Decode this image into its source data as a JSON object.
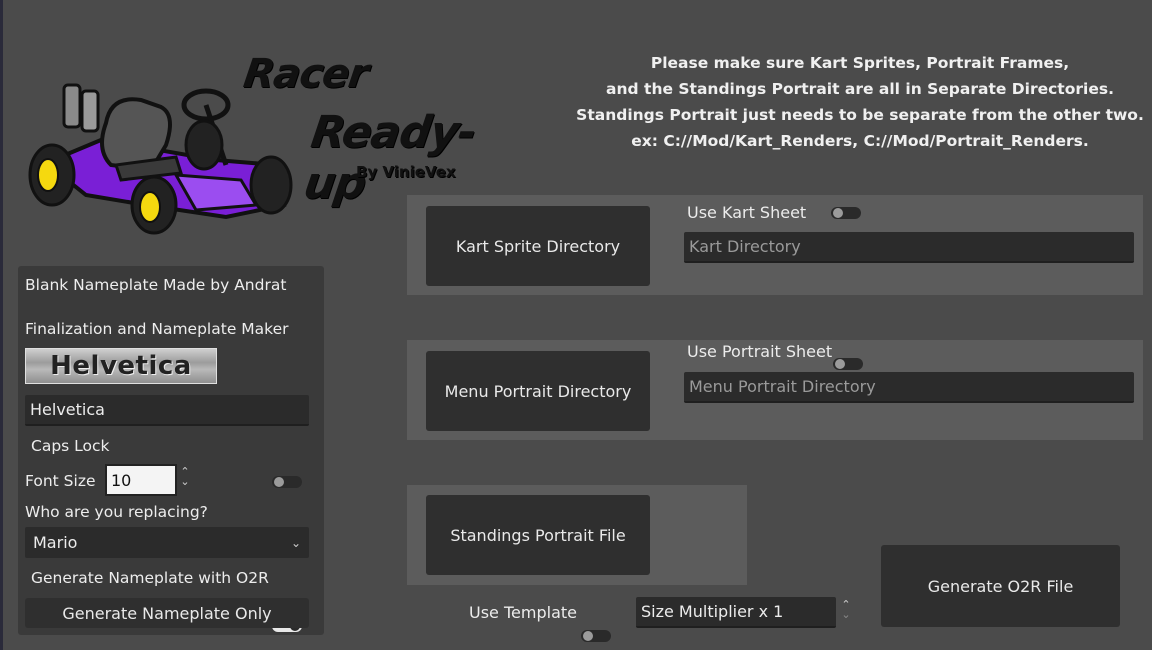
{
  "logo": {
    "title_line1": "Racer",
    "title_line2": "Ready-up",
    "byline": "By VinieVex"
  },
  "instructions": [
    "Please make sure Kart Sprites, Portrait Frames,",
    "and the Standings Portrait are all in Separate Directories.",
    "Standings Portrait just needs to be separate from the other two.",
    "ex: C://Mod/Kart_Renders, C://Mod/Portrait_Renders."
  ],
  "kart_section": {
    "button_label": "Kart Sprite Directory",
    "toggle_label": "Use Kart Sheet",
    "toggle_on": false,
    "field_placeholder": "Kart Directory"
  },
  "portrait_section": {
    "button_label": "Menu Portrait Directory",
    "toggle_label": "Use Portrait Sheet",
    "toggle_on": false,
    "field_placeholder": "Menu Portrait Directory"
  },
  "standings_section": {
    "button_label": "Standings Portrait File"
  },
  "bottom": {
    "template_label": "Use Template",
    "template_on": false,
    "size_multiplier": "Size Multiplier x 1",
    "generate_o2r_label": "Generate O2R File"
  },
  "nameplate_panel": {
    "credit": "Blank Nameplate Made by Andrat",
    "heading": "Finalization and Nameplate Maker",
    "preview_text": "Helvetica",
    "font_value": "Helvetica",
    "caps_lock_label": "Caps Lock",
    "caps_lock_on": false,
    "font_size_label": "Font Size",
    "font_size_value": "10",
    "replacing_label": "Who are you replacing?",
    "replacing_value": "Mario",
    "generate_with_o2r_label": "Generate Nameplate with O2R",
    "generate_with_o2r_on": true,
    "generate_only_label": "Generate Nameplate Only"
  },
  "colors": {
    "background": "#4b4b4b",
    "panel": "#5c5c5c",
    "button": "#2f2f2f",
    "kart_purple": "#7a1fd6",
    "wheel_yellow": "#f5d90f"
  }
}
